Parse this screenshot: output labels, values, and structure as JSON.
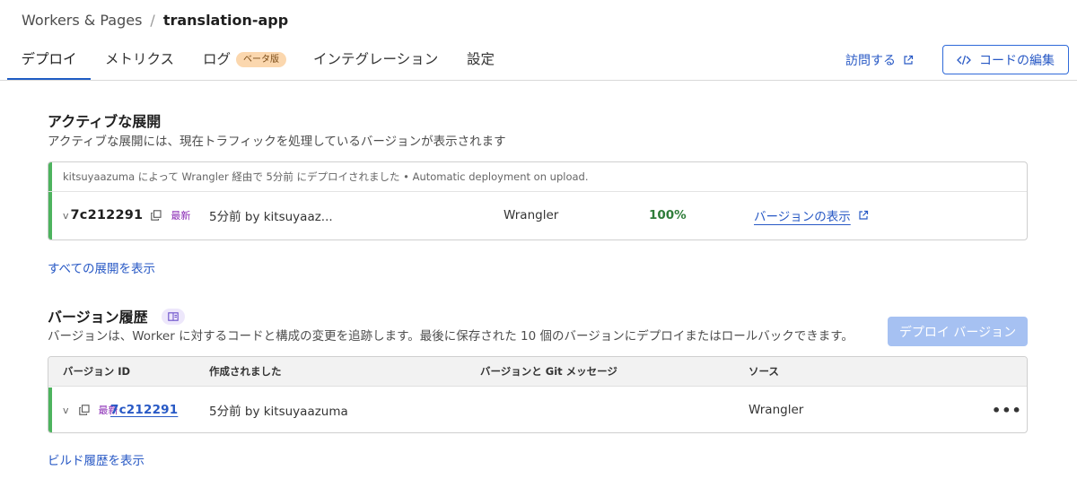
{
  "breadcrumb": {
    "parent": "Workers & Pages",
    "separator": "/",
    "current": "translation-app"
  },
  "tabs": [
    {
      "label": "デプロイ"
    },
    {
      "label": "メトリクス"
    },
    {
      "label": "ログ",
      "badge": "ベータ版"
    },
    {
      "label": "インテグレーション"
    },
    {
      "label": "設定"
    }
  ],
  "header_actions": {
    "visit_label": "訪問する",
    "edit_label": "コードの編集"
  },
  "active_deployment": {
    "title": "アクティブな展開",
    "description": "アクティブな展開には、現在トラフィックを処理しているバージョンが表示されます",
    "note": "kitsuyaazuma によって Wrangler 経由で 5分前 にデプロイされました • Automatic deployment on upload.",
    "row": {
      "v_prefix": "v",
      "version": "7c212291",
      "latest": "最新",
      "created": "5分前 by kitsuyaaz...",
      "source": "Wrangler",
      "percentage": "100%",
      "view_label": "バージョンの表示"
    },
    "all_link": "すべての展開を表示"
  },
  "version_history": {
    "title": "バージョン履歴",
    "description": "バージョンは、Worker に対するコードと構成の変更を追跡します。最後に保存された 10 個のバージョンにデプロイまたはロールバックできます。",
    "deploy_button": "デプロイ バージョン",
    "columns": [
      "バージョン ID",
      "作成されました",
      "バージョンと Git メッセージ",
      "ソース"
    ],
    "rows": [
      {
        "v_prefix": "v",
        "version": "7c212291",
        "latest": "最新",
        "created": "5分前 by kitsuyaazuma",
        "message": "",
        "source": "Wrangler",
        "menu": "•••"
      }
    ],
    "build_link": "ビルド履歴を表示"
  },
  "colors": {
    "accent_blue": "#2859c5",
    "active_green": "#4db35e",
    "latest_purple": "#8a2bb5",
    "beta_badge": "#fbd7ae",
    "disabled_button": "#a6c1f2"
  },
  "icons": [
    "copy-icon",
    "external-link-icon",
    "code-icon",
    "book-icon",
    "more-icon"
  ]
}
